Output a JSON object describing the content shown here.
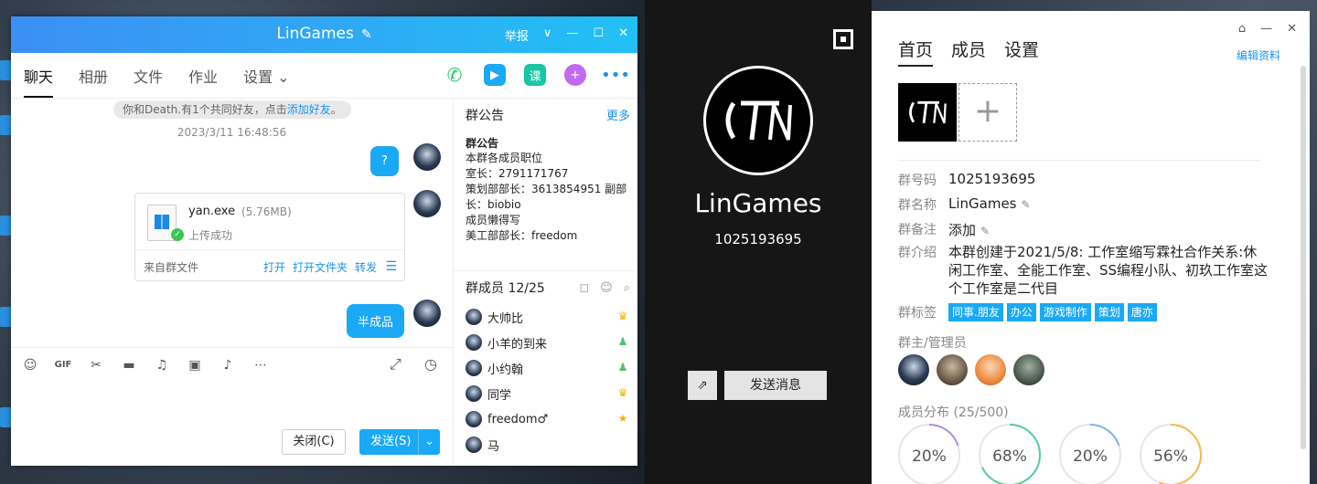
{
  "chat": {
    "title": "LinGames",
    "title_tools": [
      "举报",
      "∨",
      "—",
      "☐",
      "✕"
    ],
    "tabs": [
      "聊天",
      "相册",
      "文件",
      "作业",
      "设置"
    ],
    "notice_prefix": "你和Death.有1个共同好友，点击",
    "notice_link": "添加好友",
    "notice_suffix": "。",
    "timestamp": "2023/3/11 16:48:56",
    "msg1": "?",
    "file": {
      "name": "yan.exe",
      "size": "(5.76MB)",
      "status": "上传成功",
      "source": "来自群文件",
      "open": "打开",
      "open_folder": "打开文件夹",
      "forward": "转发"
    },
    "msg2": "半成品",
    "close_btn": "关闭(C)",
    "send_btn": "发送(S)",
    "course_icon": "课",
    "announcement": {
      "header": "群公告",
      "more": "更多",
      "title": "群公告",
      "lines": [
        "本群各成员职位",
        "室长：2791171767",
        "策划部部长：3613854951 副部",
        "长：biobio",
        "成员懒得写",
        "美工部部长：freedom"
      ]
    },
    "members_header": "群成员 12/25",
    "members": [
      {
        "name": "大帅比",
        "role": "owner"
      },
      {
        "name": "小羊的到来",
        "role": "admin"
      },
      {
        "name": "小约翰",
        "role": "admin"
      },
      {
        "name": "同学",
        "role": "owner"
      },
      {
        "name": "freedom♂",
        "role": "star"
      },
      {
        "name": "马",
        "role": ""
      }
    ]
  },
  "profile": {
    "name": "LinGames",
    "id": "1025193695",
    "send_msg": "发送消息"
  },
  "info": {
    "tabs": [
      "首页",
      "成员",
      "设置"
    ],
    "edit_link": "编辑资料",
    "fields": {
      "id_k": "群号码",
      "id_v": "1025193695",
      "name_k": "群名称",
      "name_v": "LinGames",
      "note_k": "群备注",
      "note_v": "添加",
      "intro_k": "群介绍",
      "intro_v": "本群创建于2021/5/8:  工作室缩写霖社合作关系:休闲工作室、全能工作室、SS编程小队、初玖工作室这个工作室是二代目",
      "tags_k": "群标签"
    },
    "tags": [
      "同事.朋友",
      "办公",
      "游戏制作",
      "策划",
      "唐亦"
    ],
    "admins_label": "群主/管理员",
    "dist_label": "成员分布 (25/500)",
    "dist": [
      {
        "pct": "20%",
        "value": 0.2,
        "color": "#b18cf0"
      },
      {
        "pct": "68%",
        "value": 0.68,
        "color": "#4fcf9a"
      },
      {
        "pct": "20%",
        "value": 0.2,
        "color": "#7eb6f0"
      },
      {
        "pct": "56%",
        "value": 0.56,
        "color": "#f5b84a"
      }
    ]
  }
}
